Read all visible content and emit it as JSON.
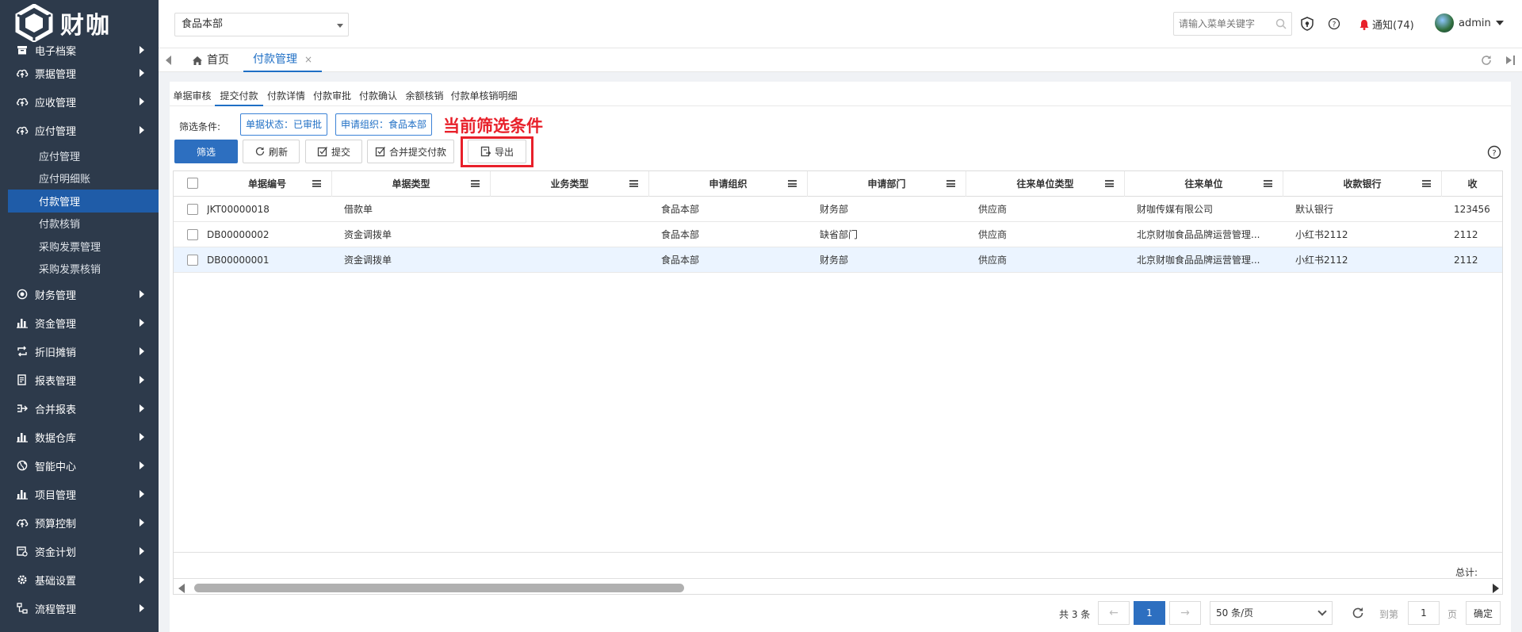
{
  "app": {
    "logo_text": "财咖"
  },
  "sidebar": {
    "items": [
      {
        "label": "电子档案",
        "icon": "archive-icon"
      },
      {
        "label": "票据管理",
        "icon": "cloud-upload-icon"
      },
      {
        "label": "应收管理",
        "icon": "cloud-upload-icon"
      },
      {
        "label": "应付管理",
        "icon": "cloud-upload-icon",
        "expanded": true,
        "children": [
          "应付管理",
          "应付明细账",
          "付款管理",
          "付款核销",
          "采购发票管理",
          "采购发票核销"
        ],
        "active_child": "付款管理"
      },
      {
        "label": "财务管理",
        "icon": "target-icon"
      },
      {
        "label": "资金管理",
        "icon": "bar-chart-icon"
      },
      {
        "label": "折旧摊销",
        "icon": "repeat-icon"
      },
      {
        "label": "报表管理",
        "icon": "report-icon"
      },
      {
        "label": "合并报表",
        "icon": "merge-icon"
      },
      {
        "label": "数据仓库",
        "icon": "bar-chart-icon"
      },
      {
        "label": "智能中心",
        "icon": "globe-icon"
      },
      {
        "label": "项目管理",
        "icon": "bar-chart-icon"
      },
      {
        "label": "预算控制",
        "icon": "cloud-upload-icon"
      },
      {
        "label": "资金计划",
        "icon": "plan-icon"
      },
      {
        "label": "基础设置",
        "icon": "gear-icon"
      },
      {
        "label": "流程管理",
        "icon": "flow-icon"
      }
    ]
  },
  "header": {
    "org_select_value": "食品本部",
    "menu_search_placeholder": "请输入菜单关键字",
    "notification_label": "通知(74)",
    "username": "admin"
  },
  "page_tabs": {
    "home": "首页",
    "current": "付款管理",
    "close_glyph": "×"
  },
  "sub_tabs": [
    "单据审核",
    "提交付款",
    "付款详情",
    "付款审批",
    "付款确认",
    "余额核销",
    "付款单核销明细"
  ],
  "active_sub_tab": "提交付款",
  "filter": {
    "label": "筛选条件:",
    "chips": [
      "单据状态：已审批",
      "申请组织：食品本部"
    ],
    "annotation": "当前筛选条件"
  },
  "toolbar": {
    "filter_button": "筛选",
    "refresh_button": "刷新",
    "submit_button": "提交",
    "merge_submit_button": "合并提交付款",
    "export_button": "导出"
  },
  "table": {
    "columns": [
      "单据编号",
      "单据类型",
      "业务类型",
      "申请组织",
      "申请部门",
      "往来单位类型",
      "往来单位",
      "收款银行",
      "收"
    ],
    "rows": [
      {
        "cells": [
          "JKT00000018",
          "借款单",
          "",
          "食品本部",
          "财务部",
          "供应商",
          "财咖传媒有限公司",
          "默认银行",
          "123456"
        ],
        "highlight": false
      },
      {
        "cells": [
          "DB00000002",
          "资金调拨单",
          "",
          "食品本部",
          "缺省部门",
          "供应商",
          "北京财咖食品品牌运营管理...",
          "小红书2112",
          "2112"
        ],
        "highlight": false
      },
      {
        "cells": [
          "DB00000001",
          "资金调拨单",
          "",
          "食品本部",
          "财务部",
          "供应商",
          "北京财咖食品品牌运营管理...",
          "小红书2112",
          "2112"
        ],
        "highlight": true
      }
    ],
    "total_label": "总计:"
  },
  "pagination": {
    "total_text": "共 3 条",
    "prev": "←",
    "current_page": "1",
    "next": "→",
    "page_size": "50 条/页",
    "goto_label": "到第",
    "goto_value": "1",
    "page_suffix": "页",
    "confirm": "确定"
  },
  "colors": {
    "sidebar_bg": "#2d3a4b",
    "active_item": "#1f5ca8",
    "primary": "#2d6fc0",
    "annotation_red": "#e8202a"
  }
}
